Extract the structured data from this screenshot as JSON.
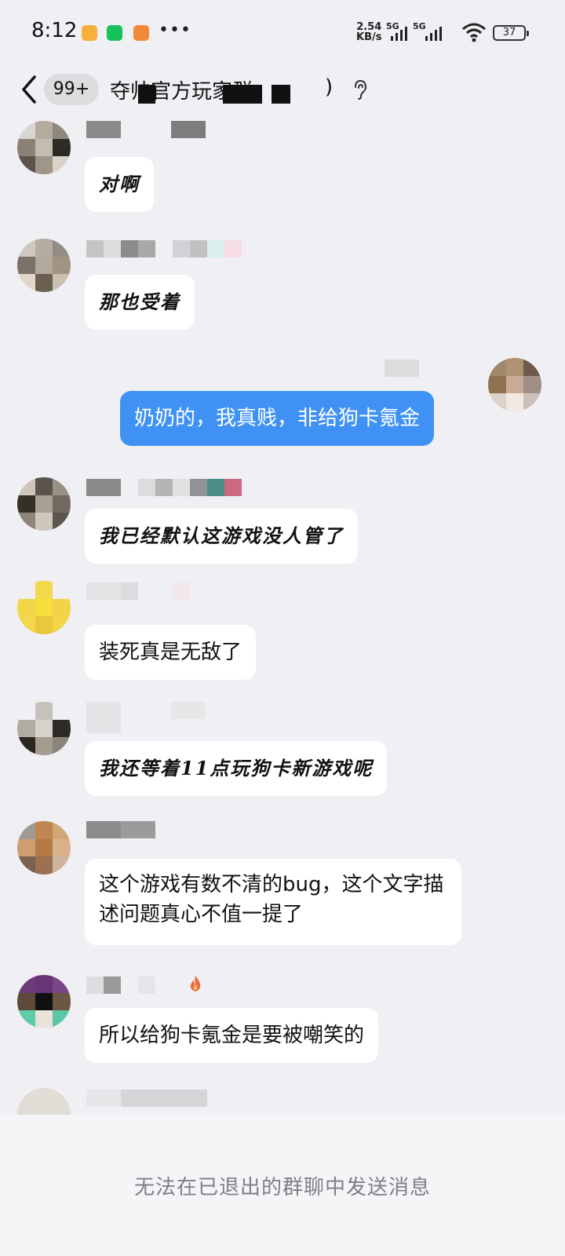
{
  "status_bar": {
    "time": "8:12",
    "speed_value": "2.54",
    "speed_unit": "KB/s",
    "net1": "5G",
    "net2": "5G",
    "battery": "37"
  },
  "nav": {
    "unread_count": "99+",
    "title_visible": "夺帅官方玩家群",
    "title_suffix": ")"
  },
  "messages": [
    {
      "text": "对啊"
    },
    {
      "text": "那也受着"
    },
    {
      "text": "奶奶的，我真贱，非给狗卡氪金",
      "mine": true
    },
    {
      "text": "我已经默认这游戏没人管了"
    },
    {
      "text": "装死真是无敌了"
    },
    {
      "text": "我还等着11点玩狗卡新游戏呢"
    },
    {
      "text": "这个游戏有数不清的bug，这个文字描述问题真心不值一提了"
    },
    {
      "text": "所以给狗卡氪金是要被嘲笑的"
    }
  ],
  "footer": {
    "notice": "无法在已退出的群聊中发送消息"
  },
  "colors": {
    "background": "#efeff4",
    "my_bubble": "#3f92f4",
    "other_bubble": "#ffffff",
    "footer_text": "#7c7f85"
  }
}
